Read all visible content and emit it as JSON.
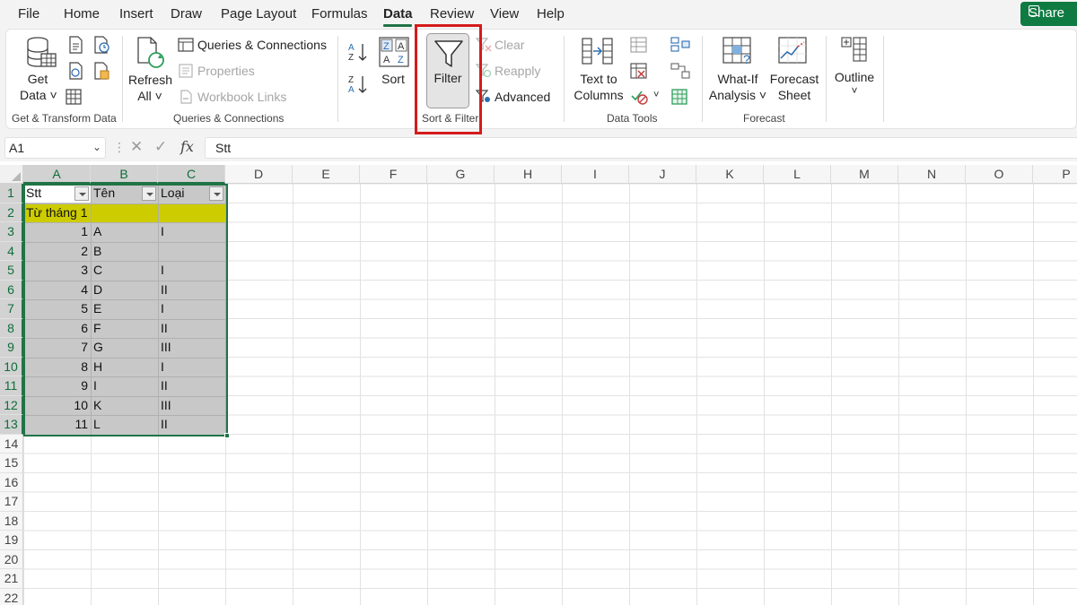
{
  "menu": {
    "tabs": [
      "File",
      "Home",
      "Insert",
      "Draw",
      "Page Layout",
      "Formulas",
      "Data",
      "Review",
      "View",
      "Help"
    ],
    "active": "Data",
    "share_label": "Share"
  },
  "ribbon": {
    "get_transform": {
      "get_data_l1": "Get",
      "get_data_l2": "Data ˅",
      "group_label": "Get & Transform Data"
    },
    "queries": {
      "refresh_l1": "Refresh",
      "refresh_l2": "All ˅",
      "queries_connections": "Queries & Connections",
      "properties": "Properties",
      "workbook_links": "Workbook Links",
      "group_label": "Queries & Connections"
    },
    "sort_filter": {
      "sort": "Sort",
      "filter": "Filter",
      "clear": "Clear",
      "reapply": "Reapply",
      "advanced": "Advanced",
      "group_label": "Sort & Filter"
    },
    "data_tools": {
      "text_to_l1": "Text to",
      "text_to_l2": "Columns",
      "group_label": "Data Tools"
    },
    "forecast": {
      "whatif_l1": "What-If",
      "whatif_l2": "Analysis ˅",
      "sheet_l1": "Forecast",
      "sheet_l2": "Sheet",
      "group_label": "Forecast"
    },
    "outline": {
      "label": "Outline",
      "chevron": "˅"
    }
  },
  "formula_bar": {
    "name_box": "A1",
    "fx": "fx",
    "content": "Stt"
  },
  "sheet": {
    "columns": [
      "A",
      "B",
      "C",
      "D",
      "E",
      "F",
      "G",
      "H",
      "I",
      "J",
      "K",
      "L",
      "M",
      "N",
      "O",
      "P"
    ],
    "rows": [
      "1",
      "2",
      "3",
      "4",
      "5",
      "6",
      "7",
      "8",
      "9",
      "10",
      "11",
      "12",
      "13",
      "14",
      "15",
      "16",
      "17",
      "18",
      "19",
      "20",
      "21",
      "22"
    ],
    "headers": [
      "Stt",
      "Tên",
      "Loại"
    ],
    "section_row": "Từ tháng 1",
    "data": [
      {
        "stt": "1",
        "ten": "A",
        "loai": "I"
      },
      {
        "stt": "2",
        "ten": "B",
        "loai": ""
      },
      {
        "stt": "3",
        "ten": "C",
        "loai": "I"
      },
      {
        "stt": "4",
        "ten": "D",
        "loai": "II"
      },
      {
        "stt": "5",
        "ten": "E",
        "loai": "I"
      },
      {
        "stt": "6",
        "ten": "F",
        "loai": "II"
      },
      {
        "stt": "7",
        "ten": "G",
        "loai": "III"
      },
      {
        "stt": "8",
        "ten": "H",
        "loai": "I"
      },
      {
        "stt": "9",
        "ten": "I",
        "loai": "II"
      },
      {
        "stt": "10",
        "ten": "K",
        "loai": "III"
      },
      {
        "stt": "11",
        "ten": "L",
        "loai": "II"
      }
    ],
    "colors": {
      "accent": "#217346",
      "section_fill": "#cccc00",
      "selection_fill": "#c8c8c8",
      "highlight": "#d51b1b"
    }
  }
}
